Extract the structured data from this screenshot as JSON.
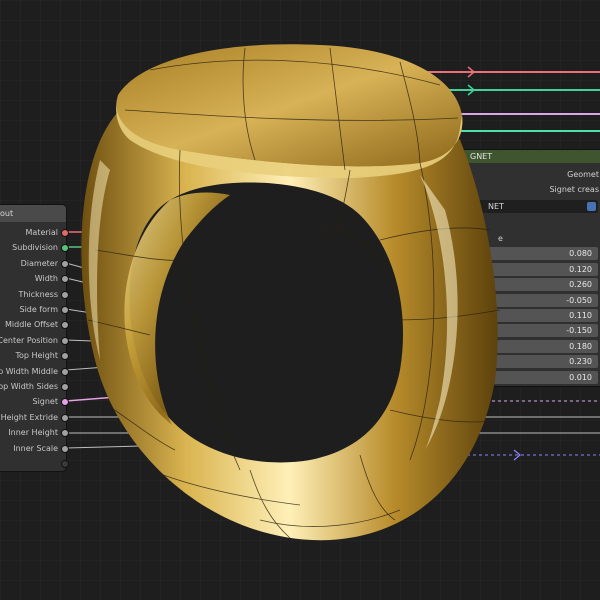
{
  "left_node": {
    "header": "out",
    "sockets": [
      {
        "label": "Material",
        "color": "#e06a6a"
      },
      {
        "label": "Subdivision",
        "color": "#5cc27a"
      },
      {
        "label": "Diameter",
        "color": "#a1a1a1"
      },
      {
        "label": "Width",
        "color": "#a1a1a1"
      },
      {
        "label": "Thickness",
        "color": "#a1a1a1"
      },
      {
        "label": "Side form",
        "color": "#a1a1a1"
      },
      {
        "label": "Middle Offset",
        "color": "#a1a1a1"
      },
      {
        "label": "Center Position",
        "color": "#a1a1a1"
      },
      {
        "label": "Top Height",
        "color": "#a1a1a1"
      },
      {
        "label": "p Width Middle",
        "color": "#a1a1a1"
      },
      {
        "label": "Top Width Sides",
        "color": "#a1a1a1"
      },
      {
        "label": "Signet",
        "color": "#e4a2e4"
      },
      {
        "label": "Height Extride",
        "color": "#a1a1a1"
      },
      {
        "label": "Inner Height",
        "color": "#a1a1a1"
      },
      {
        "label": "Inner Scale",
        "color": "#a1a1a1"
      },
      {
        "label": "",
        "color": "#3a3a3a"
      }
    ]
  },
  "right_node": {
    "header": "GNET",
    "rows": [
      "Geomet",
      "Signet creas"
    ],
    "selector": "NET",
    "sub_label": "e",
    "values": [
      "0.080",
      "0.120",
      "0.260",
      "-0.050",
      "0.110",
      "-0.150",
      "0.180",
      "0.230",
      "0.010"
    ]
  },
  "colors": {
    "background": "#1e1e1e",
    "node_body": "#303030",
    "geometry_header": "#3e5530",
    "gold": "#c9a23a",
    "wire_pink": "#e86f7a",
    "wire_green": "#3fd39a",
    "wire_purple": "#8b86ff",
    "wire_gray": "#bdbdbd"
  },
  "icons": [
    "arrow-right-icon",
    "arrow-down-icon",
    "arrow-up-icon",
    "reroute-diamond-icon"
  ]
}
